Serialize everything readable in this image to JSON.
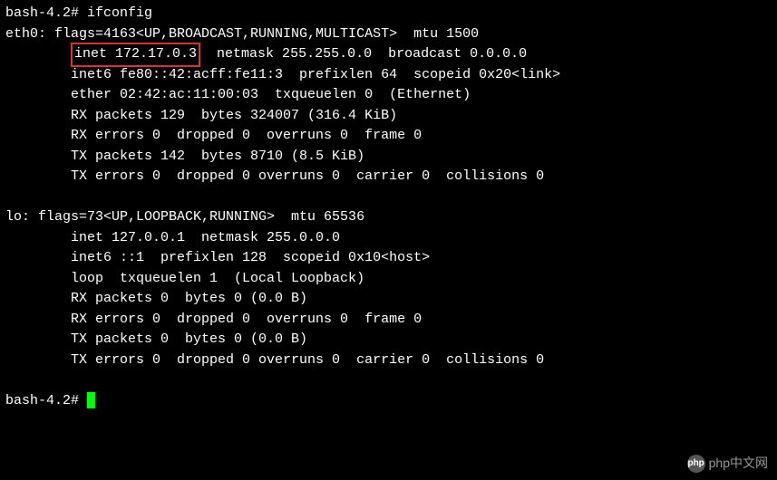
{
  "prompt1": "bash-4.2# ",
  "cmd1": "ifconfig",
  "eth0": {
    "header": "eth0: flags=4163<UP,BROADCAST,RUNNING,MULTICAST>  mtu 1500",
    "inet_hl": "inet 172.17.0.3",
    "inet_rest": "  netmask 255.255.0.0  broadcast 0.0.0.0",
    "inet6": "        inet6 fe80::42:acff:fe11:3  prefixlen 64  scopeid 0x20<link>",
    "ether": "        ether 02:42:ac:11:00:03  txqueuelen 0  (Ethernet)",
    "rxp": "        RX packets 129  bytes 324007 (316.4 KiB)",
    "rxe": "        RX errors 0  dropped 0  overruns 0  frame 0",
    "txp": "        TX packets 142  bytes 8710 (8.5 KiB)",
    "txe": "        TX errors 0  dropped 0 overruns 0  carrier 0  collisions 0"
  },
  "lo": {
    "header": "lo: flags=73<UP,LOOPBACK,RUNNING>  mtu 65536",
    "inet": "        inet 127.0.0.1  netmask 255.0.0.0",
    "inet6": "        inet6 ::1  prefixlen 128  scopeid 0x10<host>",
    "loop": "        loop  txqueuelen 1  (Local Loopback)",
    "rxp": "        RX packets 0  bytes 0 (0.0 B)",
    "rxe": "        RX errors 0  dropped 0  overruns 0  frame 0",
    "txp": "        TX packets 0  bytes 0 (0.0 B)",
    "txe": "        TX errors 0  dropped 0 overruns 0  carrier 0  collisions 0"
  },
  "prompt2": "bash-4.2# ",
  "pad8": "        ",
  "watermark": {
    "logo": "php",
    "text": "php中文网"
  }
}
